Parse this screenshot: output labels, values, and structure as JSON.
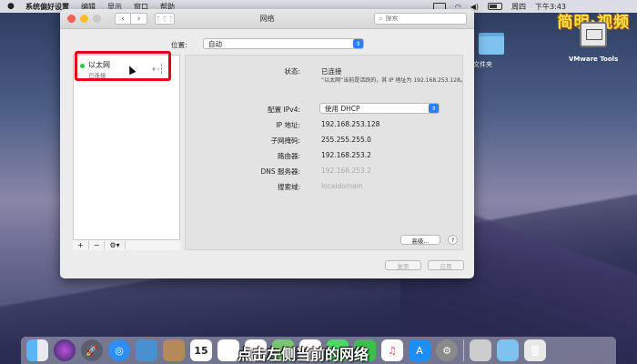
{
  "menubar": {
    "app": "系统偏好设置",
    "items": [
      "编辑",
      "显示",
      "窗口",
      "帮助"
    ],
    "clock_day": "周四",
    "clock_time": "下午3:43"
  },
  "watermark": "简明·视频",
  "desktop": {
    "folder_label": "名文件夹",
    "vm_label": "VMware Tools"
  },
  "window": {
    "title": "网络",
    "search_placeholder": "搜索",
    "location_label": "位置:",
    "location_value": "自动"
  },
  "sidebar": {
    "services": [
      {
        "name": "以太网",
        "status": "已连接",
        "status_color": "#28c840"
      }
    ],
    "add": "+",
    "remove": "−",
    "gear": "⚙▾"
  },
  "detail": {
    "status_label": "状态:",
    "status_value": "已连接",
    "status_note": "“以太网”当前是活跃的，其 IP 地址为 192.168.253.128。",
    "ipv4_label": "配置 IPv4:",
    "ipv4_value": "使用 DHCP",
    "ip_label": "IP 地址:",
    "ip_value": "192.168.253.128",
    "mask_label": "子网掩码:",
    "mask_value": "255.255.255.0",
    "router_label": "路由器:",
    "router_value": "192.168.253.2",
    "dns_label": "DNS 服务器:",
    "dns_value": "192.168.253.2",
    "search_domain_label": "搜索域:",
    "search_domain_value": "localdomain",
    "advanced": "高级...",
    "help": "?"
  },
  "actions": {
    "revert": "复原",
    "apply": "应用"
  },
  "subtitle": "点击左侧当前的网络",
  "dock": {
    "calendar_day": "15"
  }
}
